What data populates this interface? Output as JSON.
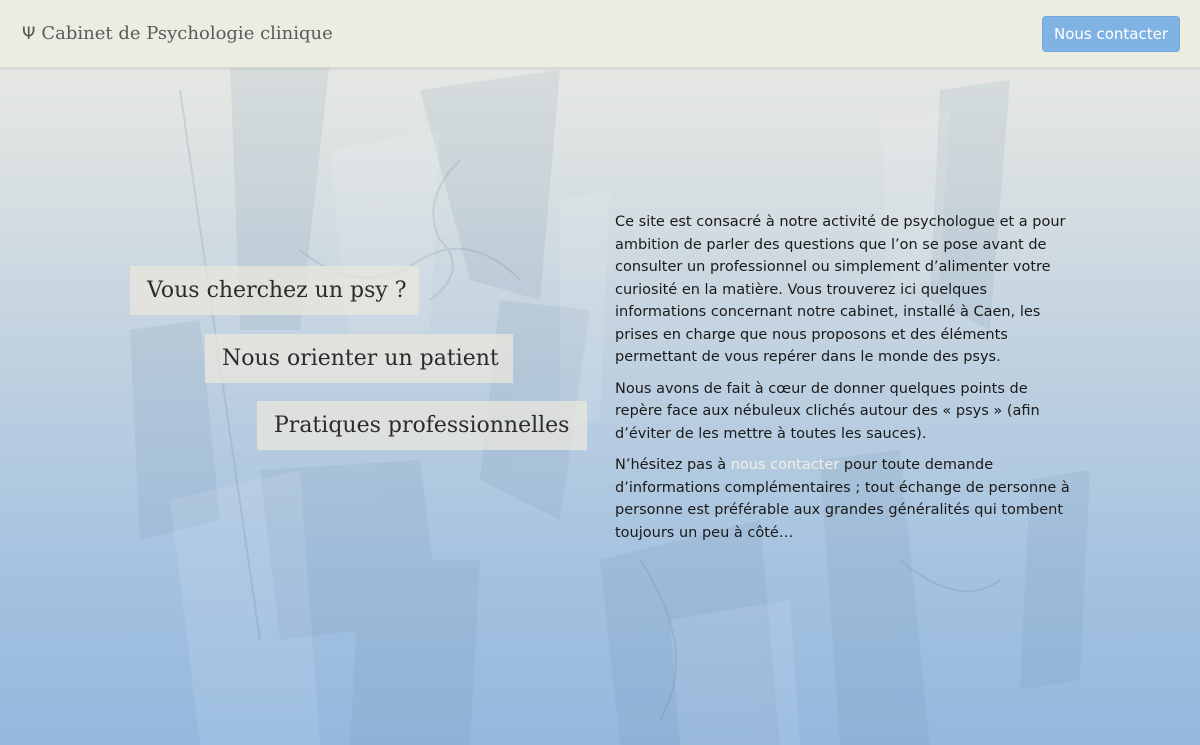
{
  "navbar": {
    "brand_icon": "psi-icon",
    "brand_icon_glyph": "Ψ",
    "brand_title": "Cabinet de Psychologie clinique",
    "contact_button": "Nous contacter"
  },
  "nav_cards": [
    {
      "label": "Vous cherchez un psy ?"
    },
    {
      "label": "Nous orienter un patient"
    },
    {
      "label": "Pratiques professionnelles"
    }
  ],
  "intro": {
    "paragraph1": "Ce site est consacré à notre activité de psychologue et a pour ambition de parler des questions que l’on se pose avant de consulter un professionnel ou simplement d’alimenter votre curiosité en la matière. Vous trouverez ici quelques informations concernant notre cabinet, installé à Caen, les prises en charge que nous proposons et des éléments permettant de vous repérer dans le monde des psys.",
    "paragraph2": "Nous avons de fait à cœur de donner quelques points de repère face aux nébuleux clichés autour des « psys » (afin d’éviter de les mettre à toutes les sauces).",
    "paragraph3_before": "N’hésitez pas à ",
    "paragraph3_link": "nous contacter",
    "paragraph3_after": " pour toute demande d’informations complémentaires ; tout échange de personne à personne est préférable aux grandes généralités qui tombent toujours un peu à côté…"
  },
  "colors": {
    "accent_button": "#80b3e3",
    "background_top": "#eeeee6",
    "background_bottom": "#94b8de",
    "link": "#f3f0e4"
  }
}
